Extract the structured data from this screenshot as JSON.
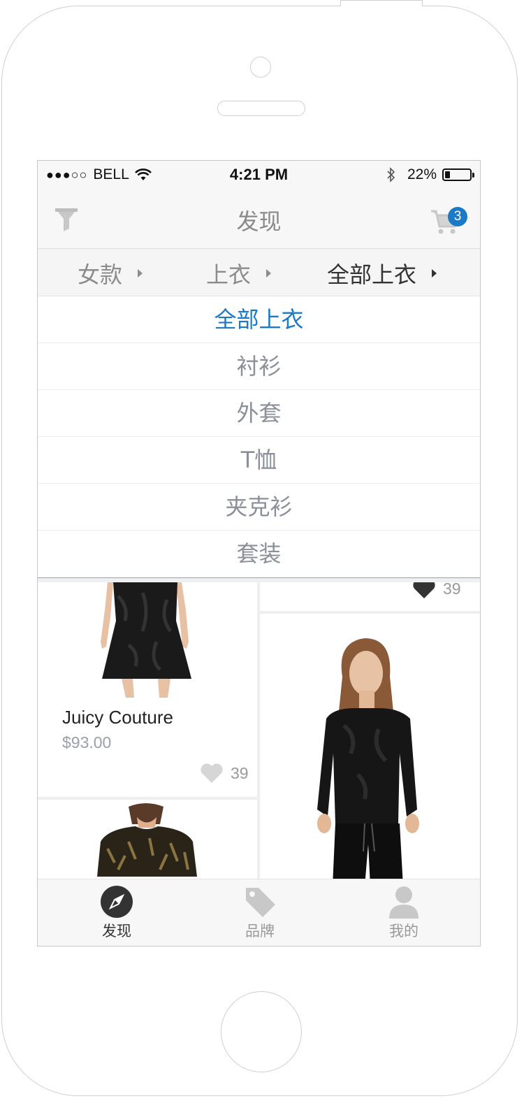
{
  "status_bar": {
    "signal": "●●●○○",
    "carrier": "BELL",
    "time": "4:21 PM",
    "battery_text": "22%",
    "battery_level": 0.22
  },
  "nav": {
    "title": "发现",
    "cart_count": "3"
  },
  "breadcrumb": [
    {
      "label": "女款"
    },
    {
      "label": "上衣"
    },
    {
      "label": "全部上衣"
    }
  ],
  "dropdown": {
    "items": [
      "全部上衣",
      "衬衫",
      "外套",
      "T恤",
      "夹克衫",
      "套装"
    ],
    "selected_index": 0
  },
  "products": {
    "top_right_likes": "39",
    "card1": {
      "brand": "Juicy Couture",
      "price": "$93.00",
      "likes": "39"
    }
  },
  "tabs": [
    {
      "label": "发现",
      "icon": "compass-icon",
      "active": true
    },
    {
      "label": "品牌",
      "icon": "tag-icon",
      "active": false
    },
    {
      "label": "我的",
      "icon": "user-icon",
      "active": false
    }
  ],
  "colors": {
    "accent": "#1a7ac8",
    "inactive": "#999999",
    "heart_dark": "#333333",
    "heart_light": "#d6d6d6"
  }
}
